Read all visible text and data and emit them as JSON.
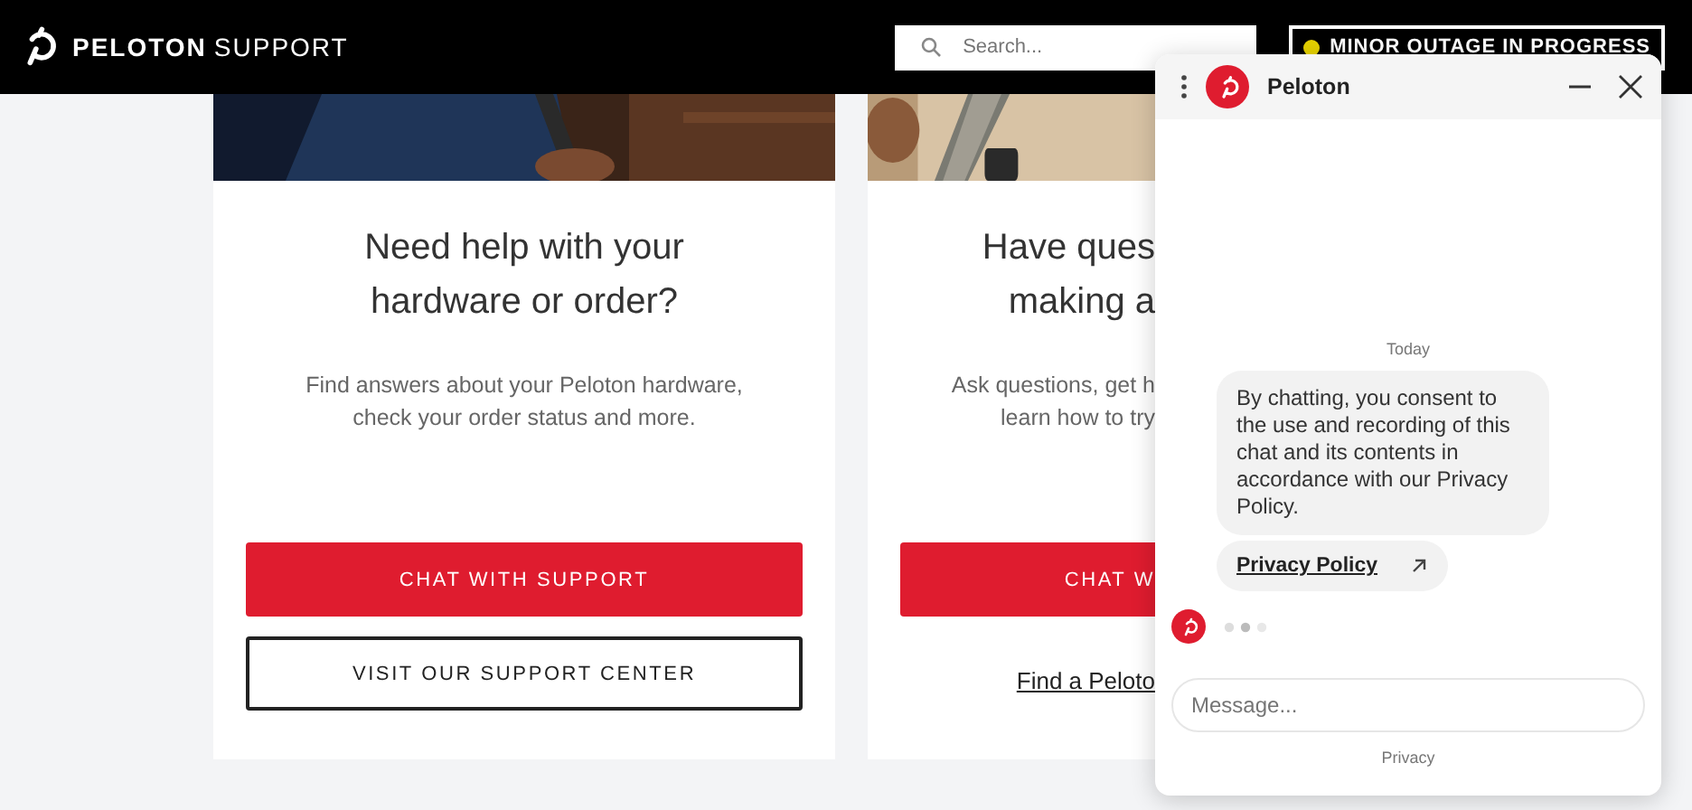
{
  "header": {
    "brand": "PELOTON",
    "brand_suffix": "SUPPORT",
    "search": {
      "placeholder": "Search..."
    },
    "status_badge": {
      "label": "MINOR OUTAGE IN PROGRESS",
      "color": "#e6d200"
    }
  },
  "cards": [
    {
      "kind": "full",
      "heading": "Need help with your hardware or order?",
      "text": "Find answers about your Peloton hardware, check your order status and more.",
      "primary_button": "CHAT WITH SUPPORT",
      "secondary_button": "VISIT OUR SUPPORT CENTER"
    },
    {
      "kind": "cut",
      "heading_lines": [
        "Have ques",
        "making a"
      ],
      "text_lines": [
        "Ask questions, get h",
        "learn how to try"
      ],
      "primary_button": "CHAT W",
      "link": "Find a Peloto"
    }
  ],
  "chat": {
    "title": "Peloton",
    "day": "Today",
    "message": "By chatting, you consent to the use and recording of this chat and its contents in accordance with our Privacy Policy.",
    "link": "Privacy Policy",
    "typing": true,
    "input": {
      "placeholder": "Message..."
    },
    "footer": "Privacy"
  }
}
